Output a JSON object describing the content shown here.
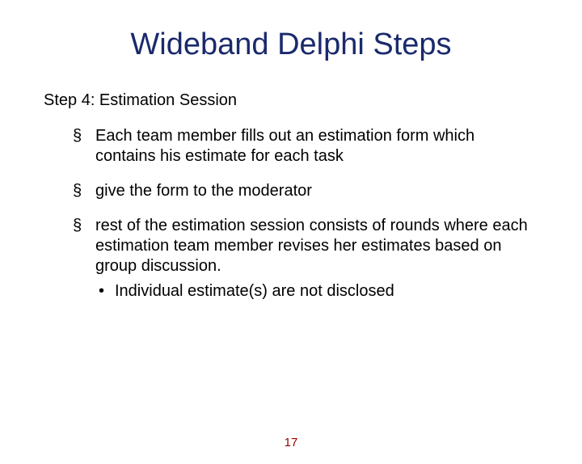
{
  "title": "Wideband Delphi Steps",
  "subtitle": "Step 4: Estimation Session",
  "bullets": [
    {
      "text": "Each team member fills out an estimation form which contains his estimate for each task"
    },
    {
      "text": "give the form to the moderator"
    },
    {
      "text": "rest of the estimation session consists of rounds where each estimation team member revises her estimates based on group discussion.",
      "sub": "Individual estimate(s) are not disclosed"
    }
  ],
  "page_number": "17"
}
